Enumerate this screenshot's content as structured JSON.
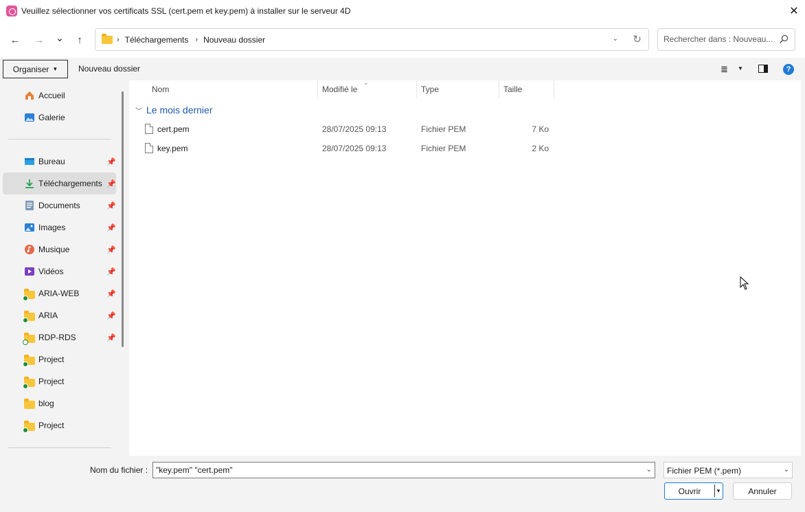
{
  "window": {
    "title": "Veuillez sélectionner vos certificats SSL (cert.pem et key.pem) à installer sur le serveur 4D",
    "close_glyph": "✕"
  },
  "nav": {
    "back_glyph": "←",
    "forward_glyph": "→",
    "recent_glyph": "⌄",
    "up_glyph": "↑",
    "breadcrumbs": [
      "Téléchargements",
      "Nouveau dossier"
    ],
    "separator": "›",
    "dropdown_glyph": "⌄",
    "refresh_glyph": "↻"
  },
  "search": {
    "placeholder": "Rechercher dans : Nouveau..."
  },
  "toolbar": {
    "organize_label": "Organiser",
    "new_folder_label": "Nouveau dossier",
    "view_glyph": "≣",
    "caret_glyph": "▼",
    "help_glyph": "?"
  },
  "sidebar": {
    "pin_glyph": "📌",
    "items": [
      {
        "label": "Accueil",
        "icon": "home-icon"
      },
      {
        "label": "Galerie",
        "icon": "gallery-icon"
      },
      {
        "label": "Bureau",
        "icon": "desktop-icon",
        "pinned": true
      },
      {
        "label": "Téléchargements",
        "icon": "download-icon",
        "pinned": true,
        "selected": true
      },
      {
        "label": "Documents",
        "icon": "documents-icon",
        "pinned": true
      },
      {
        "label": "Images",
        "icon": "pictures-icon",
        "pinned": true
      },
      {
        "label": "Musique",
        "icon": "music-icon",
        "pinned": true
      },
      {
        "label": "Vidéos",
        "icon": "videos-icon",
        "pinned": true
      },
      {
        "label": "ARIA-WEB",
        "icon": "synced-folder-icon",
        "pinned": true
      },
      {
        "label": "ARIA",
        "icon": "synced-folder-icon",
        "pinned": true
      },
      {
        "label": "RDP-RDS",
        "icon": "cloud-folder-icon",
        "pinned": true
      },
      {
        "label": "Project",
        "icon": "synced-folder-icon"
      },
      {
        "label": "Project",
        "icon": "synced-folder-icon"
      },
      {
        "label": "blog",
        "icon": "folder-icon"
      },
      {
        "label": "Project",
        "icon": "synced-folder-icon"
      }
    ]
  },
  "table": {
    "columns": [
      "Nom",
      "Modifié le",
      "Type",
      "Taille"
    ],
    "group_label": "Le mois dernier",
    "group_glyph": "﹀",
    "sort_glyph": "⌄",
    "rows": [
      {
        "name": "cert.pem",
        "modified": "28/07/2025 09:13",
        "type": "Fichier PEM",
        "size": "7 Ko"
      },
      {
        "name": "key.pem",
        "modified": "28/07/2025 09:13",
        "type": "Fichier PEM",
        "size": "2 Ko"
      }
    ]
  },
  "footer": {
    "filename_label": "Nom du fichier :",
    "filename_value": "\"key.pem\" \"cert.pem\"",
    "filter_value": "Fichier PEM (*.pem)",
    "dd_glyph": "⌄",
    "open_label": "Ouvrir",
    "split_glyph": "▾",
    "cancel_label": "Annuler"
  },
  "colors": {
    "accent": "#1f7ad8",
    "group_header": "#1e5aa8",
    "folder": "#f8c63b",
    "sync_badge": "#1f8f3c"
  }
}
